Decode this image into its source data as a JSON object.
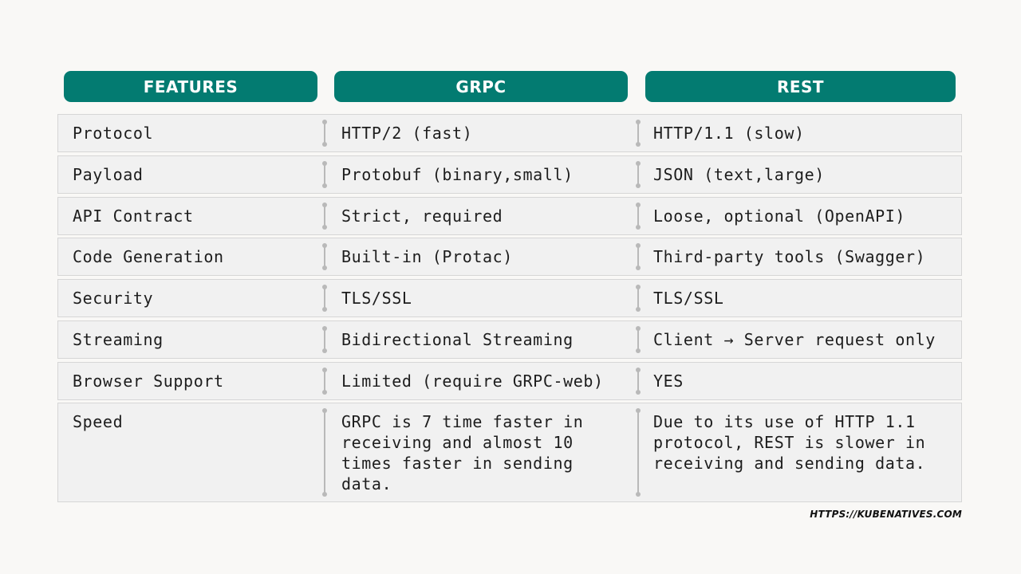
{
  "headers": {
    "features": "FEATURES",
    "grpc": "GRPC",
    "rest": "REST"
  },
  "rows": [
    {
      "feature": "Protocol",
      "grpc": "HTTP/2 (fast)",
      "rest": "HTTP/1.1 (slow)"
    },
    {
      "feature": "Payload",
      "grpc": "Protobuf (binary,small)",
      "rest": "JSON (text,large)"
    },
    {
      "feature": "API Contract",
      "grpc": "Strict, required",
      "rest": "Loose, optional (OpenAPI)"
    },
    {
      "feature": "Code Generation",
      "grpc": "Built-in (Protac)",
      "rest": "Third-party tools (Swagger)"
    },
    {
      "feature": "Security",
      "grpc": "TLS/SSL",
      "rest": "TLS/SSL"
    },
    {
      "feature": "Streaming",
      "grpc": "Bidirectional Streaming",
      "rest": "Client → Server request only"
    },
    {
      "feature": "Browser Support",
      "grpc": "Limited (require GRPC-web)",
      "rest": "YES"
    },
    {
      "feature": "Speed",
      "grpc": "GRPC is 7 time faster in receiving and almost 10 times faster in sending data.",
      "rest": "Due to its use of HTTP 1.1 protocol, REST is slower in receiving and sending data."
    }
  ],
  "footer": {
    "url": "HTTPS://KUBENATIVES.COM"
  },
  "colors": {
    "header_bg": "#037b71",
    "header_text": "#ffffff",
    "row_bg": "#f1f1f1",
    "page_bg": "#f9f8f6"
  }
}
